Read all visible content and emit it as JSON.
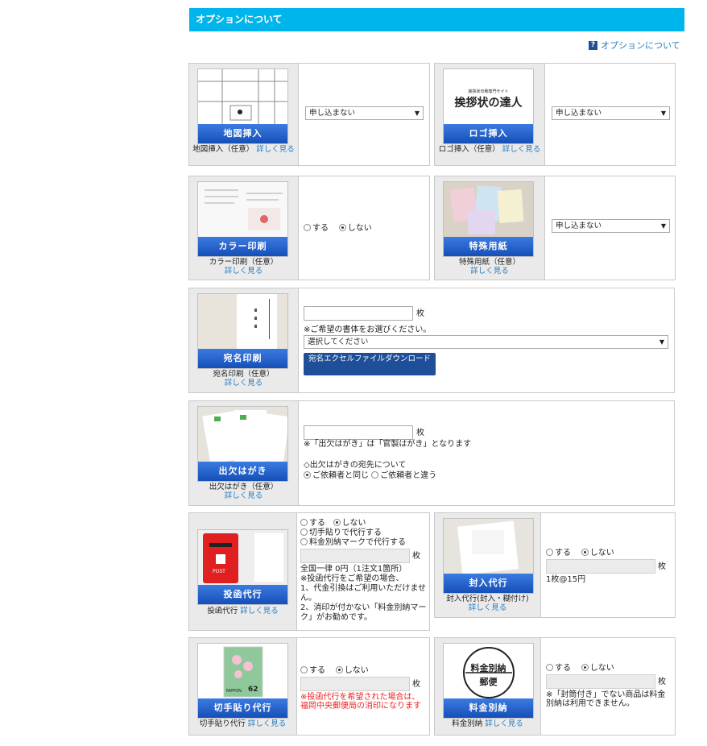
{
  "header": {
    "title": "オプションについて"
  },
  "help_link": {
    "icon": "?",
    "label": "オプションについて"
  },
  "options": {
    "map": {
      "band": "地図挿入",
      "caption": "地図挿入（任意）",
      "detail": "詳しく見る",
      "select": "申し込まない"
    },
    "logo": {
      "band": "ロゴ挿入",
      "caption": "ロゴ挿入（任意）",
      "detail": "詳しく見る",
      "select": "申し込まない",
      "logo_small": "挨拶状印刷専門サイト",
      "logo_main": "挨拶状の達人"
    },
    "color": {
      "band": "カラー印刷",
      "caption": "カラー印刷（任意）",
      "detail": "詳しく見る",
      "yes": "する",
      "no": "しない"
    },
    "paper": {
      "band": "特殊用紙",
      "caption": "特殊用紙（任意）",
      "detail": "詳しく見る",
      "select": "申し込まない"
    },
    "address": {
      "band": "宛名印刷",
      "caption": "宛名印刷（任意）",
      "detail": "詳しく見る",
      "unit": "枚",
      "note": "※ご希望の書体をお選びください。",
      "select": "選択してください",
      "download": "宛名エクセルファイルダウンロード"
    },
    "rsvp": {
      "band": "出欠はがき",
      "caption": "出欠はがき（任意）",
      "detail": "詳しく見る",
      "unit": "枚",
      "note": "※「出欠はがき」は「官製はがき」となります",
      "dest_title": "◇出欠はがきの宛先について",
      "same": "ご依頼者と同じ",
      "diff": "ご依頼者と違う"
    },
    "posting": {
      "band": "投函代行",
      "caption": "投函代行",
      "detail": "詳しく見る",
      "yes": "する",
      "no": "しない",
      "stamp": "切手貼りで代行する",
      "mark": "料金別納マークで代行する",
      "unit": "枚",
      "price": "全国一律 0円（1注文1箇所）",
      "note1": "※投函代行をご希望の場合、",
      "note2": "1、代金引換はご利用いただけません。",
      "note3": "2、消印が付かない「料金別納マーク」がお勧めです。",
      "post_label": "POST"
    },
    "enclose": {
      "band": "封入代行",
      "caption": "封入代行(封入・糊付け)",
      "detail": "詳しく見る",
      "yes": "する",
      "no": "しない",
      "unit": "枚",
      "price": "1枚@15円"
    },
    "stamp": {
      "band": "切手貼り代行",
      "caption": "切手貼り代行",
      "detail": "詳しく見る",
      "yes": "する",
      "no": "しない",
      "unit": "枚",
      "note": "※投函代行を希望された場合は、福岡中央郵便局の消印になります",
      "stamp_value": "62",
      "stamp_country": "NIPPON"
    },
    "bulk": {
      "band": "料金別納",
      "caption": "料金別納",
      "detail": "詳しく見る",
      "yes": "する",
      "no": "しない",
      "unit": "枚",
      "note": "※「封筒付き」でない商品は料金別納は利用できません。",
      "seal_line1": "料金別納",
      "seal_line2": "郵便"
    }
  },
  "colors": {
    "header": "#00b4ec",
    "band": "#2a66d0",
    "link": "#2a7ec0",
    "warn": "#e22"
  }
}
